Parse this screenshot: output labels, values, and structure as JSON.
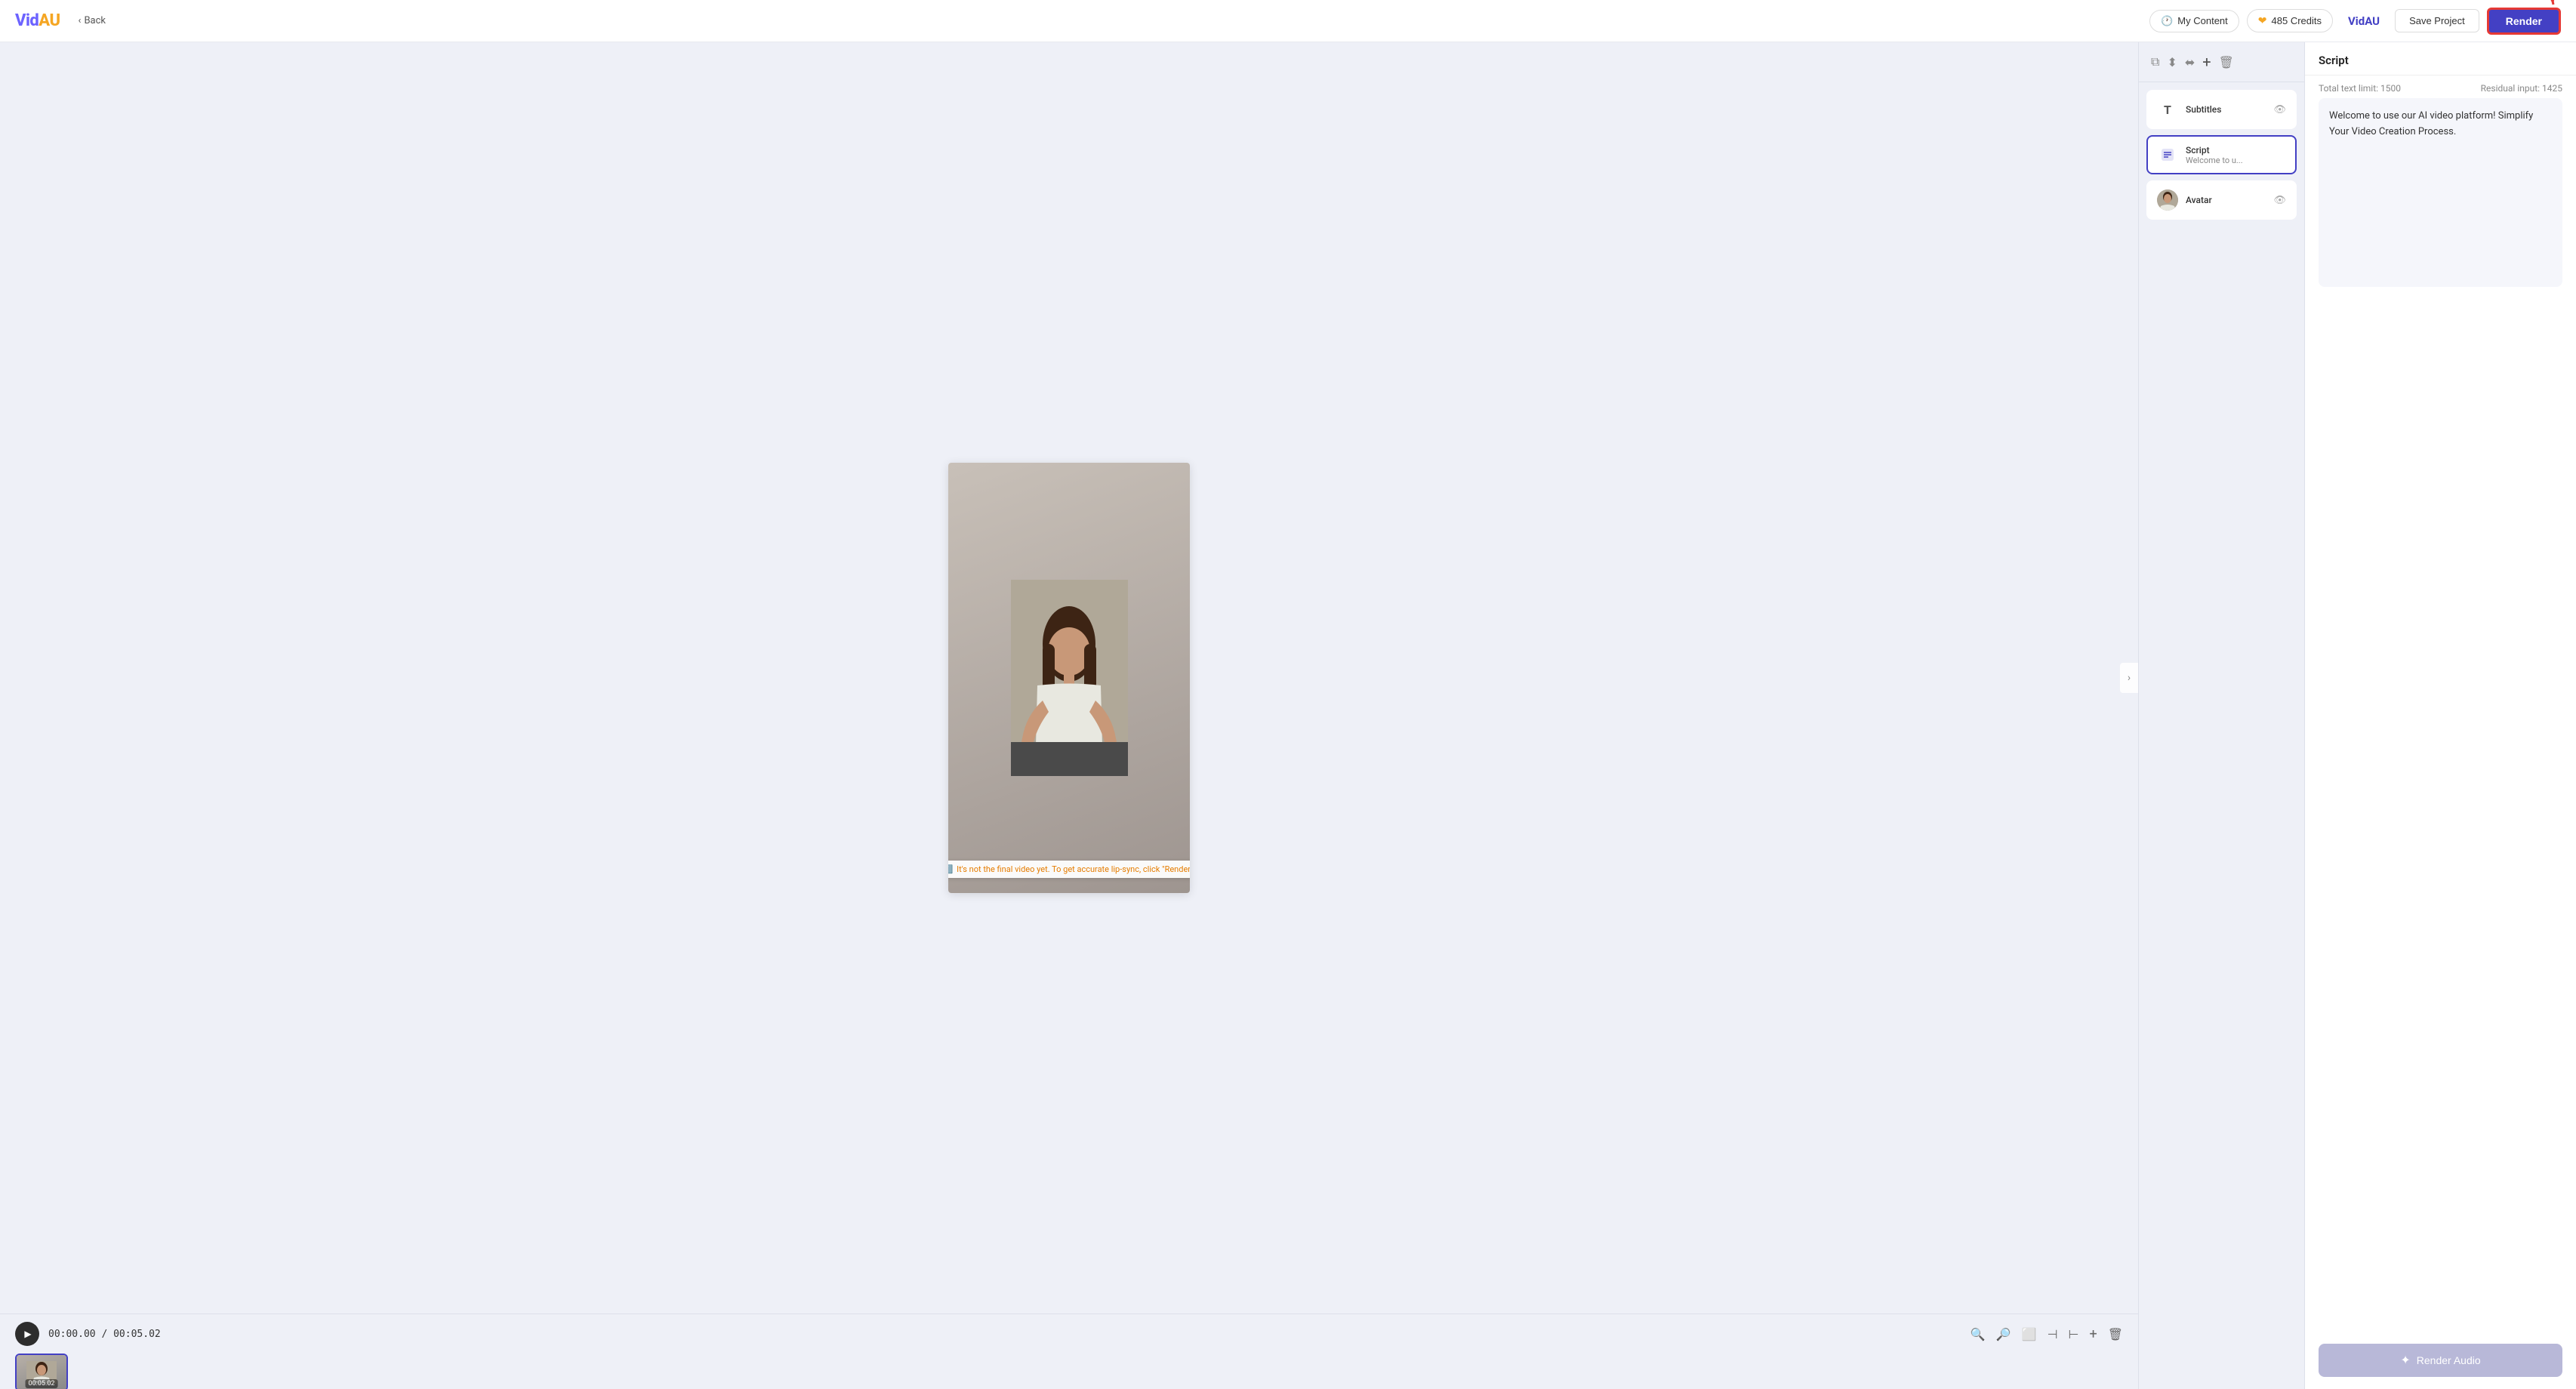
{
  "header": {
    "logo": "VidAU",
    "back_label": "Back",
    "my_content_label": "My Content",
    "credits_label": "485 Credits",
    "brand_label": "VidAU",
    "save_project_label": "Save Project",
    "render_label": "Render"
  },
  "sidebar": {
    "layers": [
      {
        "id": "subtitles",
        "icon": "T",
        "title": "Subtitles",
        "subtitle": "",
        "has_eye": true,
        "active": false,
        "type": "text"
      },
      {
        "id": "script",
        "icon": "script",
        "title": "Script",
        "subtitle": "Welcome to u...",
        "has_eye": false,
        "active": true,
        "type": "script"
      },
      {
        "id": "avatar",
        "icon": "avatar",
        "title": "Avatar",
        "subtitle": "",
        "has_eye": true,
        "active": false,
        "type": "avatar"
      }
    ]
  },
  "script_panel": {
    "title": "Script",
    "total_text_limit_label": "Total text limit: 1500",
    "residual_input_label": "Residual input: 1425",
    "content": "Welcome to use our AI video platform! Simplify Your Video Creation Process.",
    "render_audio_label": "Render Audio"
  },
  "timeline": {
    "time_current": "00:00.00",
    "time_total": "00:05.02",
    "thumb_duration": "00:05.02"
  },
  "warning": {
    "text": "It's not the final video yet. To get accurate lip-sync, click \"Render\"."
  }
}
